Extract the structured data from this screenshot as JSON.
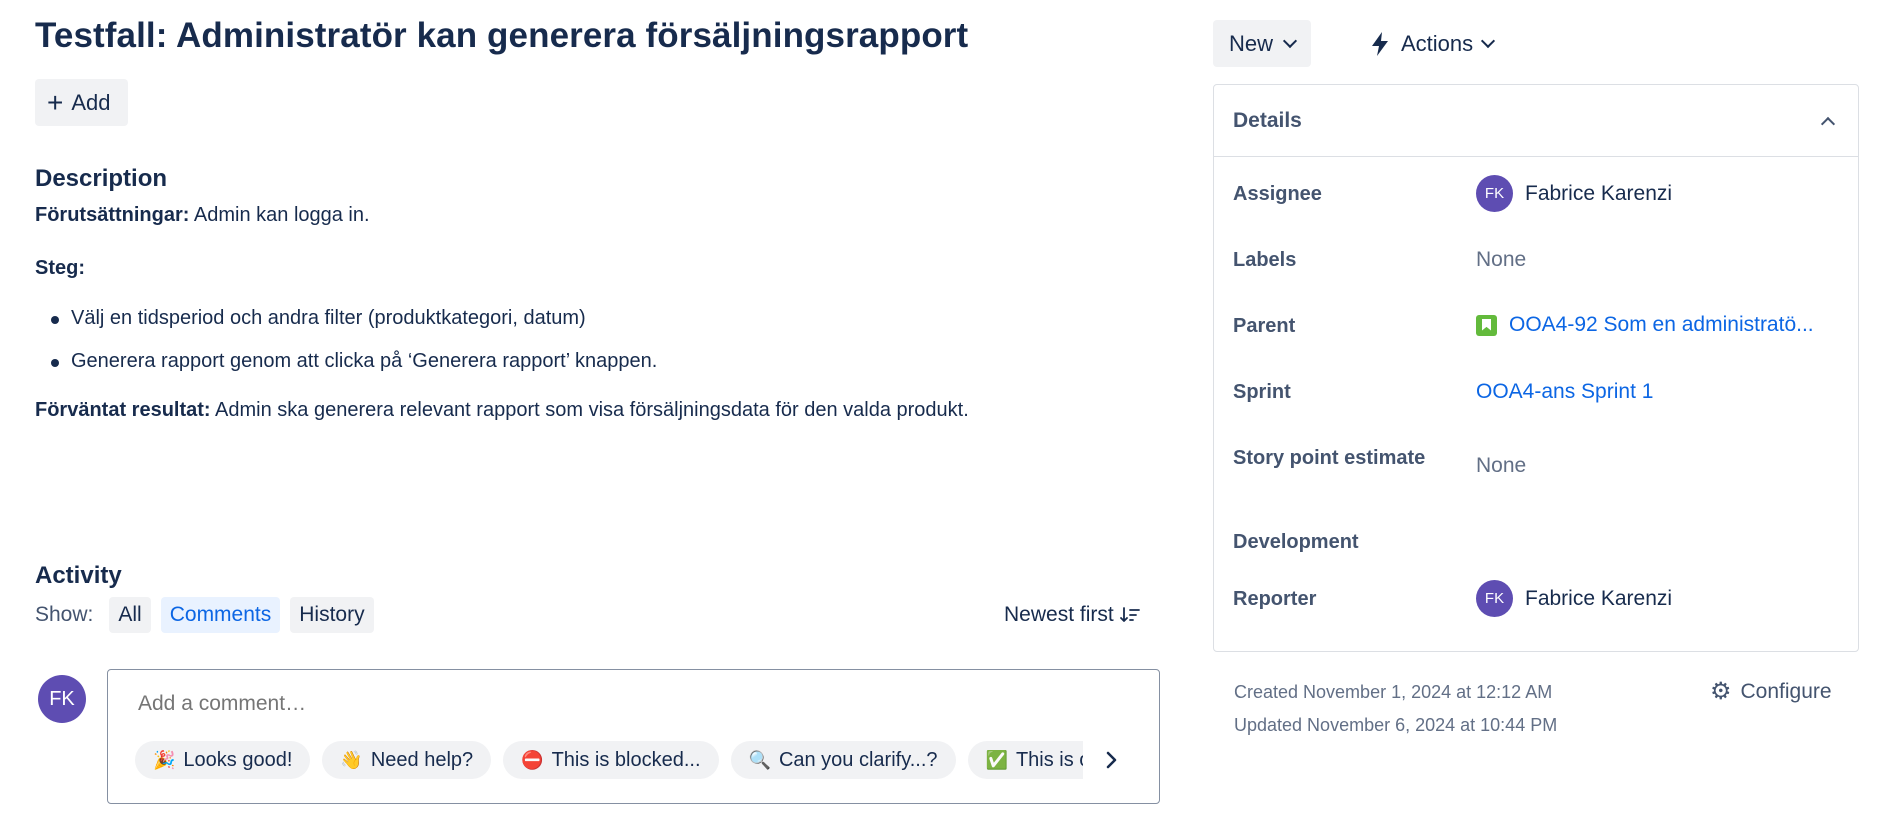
{
  "issue": {
    "title": "Testfall: Administratör kan generera försäljningsrapport",
    "add_label": "Add"
  },
  "description": {
    "heading": "Description",
    "preconditions_label": "Förutsättningar:",
    "preconditions_text": " Admin kan logga in.",
    "steps_label": "Steg:",
    "steps": [
      "Välj en tidsperiod och andra filter (produktkategori, datum)",
      "Generera rapport genom att clicka på ‘Generera rapport’ knappen."
    ],
    "expected_label": "Förväntat resultat:",
    "expected_text": " Admin ska generera relevant rapport som visa försäljningsdata för den valda produkt."
  },
  "activity": {
    "heading": "Activity",
    "show_label": "Show:",
    "filters": [
      "All",
      "Comments",
      "History"
    ],
    "active_filter": "Comments",
    "sort_label": "Newest first",
    "avatar_initials": "FK",
    "comment_placeholder": "Add a comment…",
    "quick_replies": [
      {
        "emoji": "🎉",
        "label": "Looks good!"
      },
      {
        "emoji": "👋",
        "label": "Need help?"
      },
      {
        "emoji": "⛔",
        "label": "This is blocked..."
      },
      {
        "emoji": "🔍",
        "label": "Can you clarify...?"
      },
      {
        "emoji": "✅",
        "label": "This is on track"
      }
    ]
  },
  "toolbar": {
    "status_label": "New",
    "actions_label": "Actions"
  },
  "details": {
    "heading": "Details",
    "fields": {
      "assignee_label": "Assignee",
      "assignee_initials": "FK",
      "assignee_name": "Fabrice Karenzi",
      "labels_label": "Labels",
      "labels_value": "None",
      "parent_label": "Parent",
      "parent_value": "OOA4-92 Som en administratö...",
      "sprint_label": "Sprint",
      "sprint_value": "OOA4-ans Sprint 1",
      "story_points_label": "Story point estimate",
      "story_points_value": "None",
      "development_label": "Development",
      "reporter_label": "Reporter",
      "reporter_initials": "FK",
      "reporter_name": "Fabrice Karenzi"
    }
  },
  "footer": {
    "created": "Created November 1, 2024 at 12:12 AM",
    "updated": "Updated November 6, 2024 at 10:44 PM",
    "configure_label": "Configure"
  },
  "colors": {
    "text": "#172b4d",
    "subtle_text": "#44546f",
    "link": "#0c66e4",
    "avatar": "#5e4db2",
    "story": "#63ba3c",
    "button_bg": "#f1f2f4"
  }
}
